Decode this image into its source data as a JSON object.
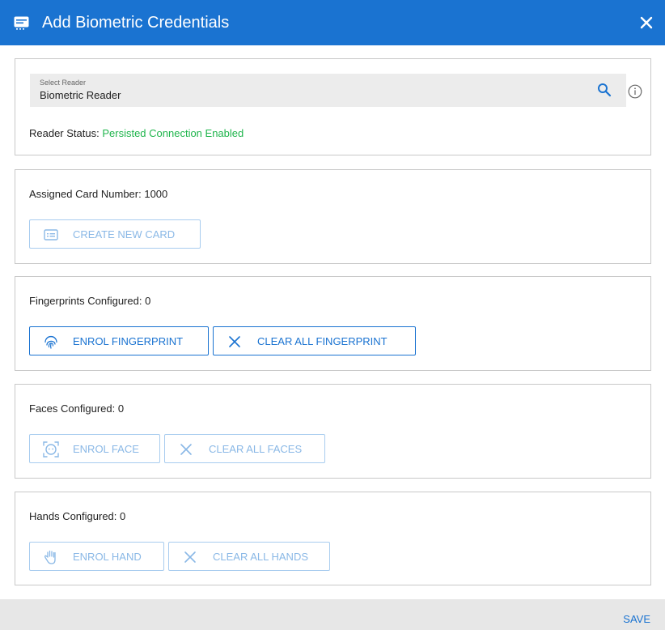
{
  "header": {
    "title": "Add Biometric Credentials",
    "icon": "card-icon",
    "close_icon": "close-icon",
    "bg_color": "#1a73d1"
  },
  "reader": {
    "select_label": "Select Reader",
    "select_value": "Biometric Reader",
    "status_label": "Reader Status:",
    "status_value": "Persisted Connection Enabled",
    "status_color": "#1fb54c"
  },
  "card": {
    "assigned_text": "Assigned Card Number: 1000",
    "create_button": "CREATE NEW CARD"
  },
  "fingerprints": {
    "configured_text": "Fingerprints Configured: 0",
    "enrol_button": "ENROL FINGERPRINT",
    "clear_button": "CLEAR ALL FINGERPRINT"
  },
  "faces": {
    "configured_text": "Faces Configured: 0",
    "enrol_button": "ENROL FACE",
    "clear_button": "CLEAR ALL FACES"
  },
  "hands": {
    "configured_text": "Hands Configured: 0",
    "enrol_button": "ENROL HAND",
    "clear_button": "CLEAR ALL HANDS"
  },
  "footer": {
    "save_label": "SAVE"
  }
}
